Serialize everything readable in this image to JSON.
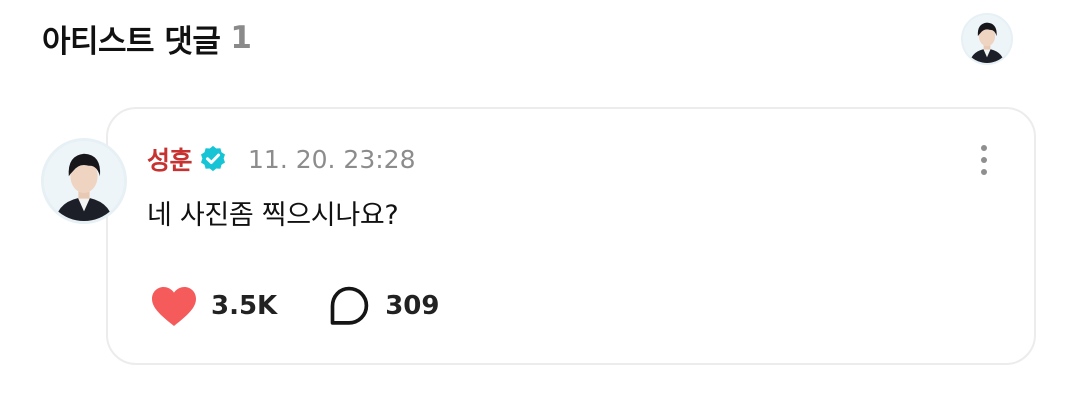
{
  "header": {
    "title": "아티스트 댓글",
    "count": "1"
  },
  "comment": {
    "author": "성훈",
    "timestamp": "11. 20. 23:28",
    "text": "네 사진좀 찍으시나요?",
    "likes": "3.5K",
    "replies": "309"
  },
  "icons": {
    "verified": "verified-badge-icon",
    "more": "vertical-ellipsis-icon",
    "like": "heart-icon",
    "reply": "speech-bubble-icon"
  },
  "colors": {
    "author_name": "#c7312f",
    "verified_badge": "#17c4d6",
    "heart": "#f55b5b",
    "timestamp": "#8c8c8c",
    "count_muted": "#8a8a8a",
    "card_border": "#ececec"
  }
}
